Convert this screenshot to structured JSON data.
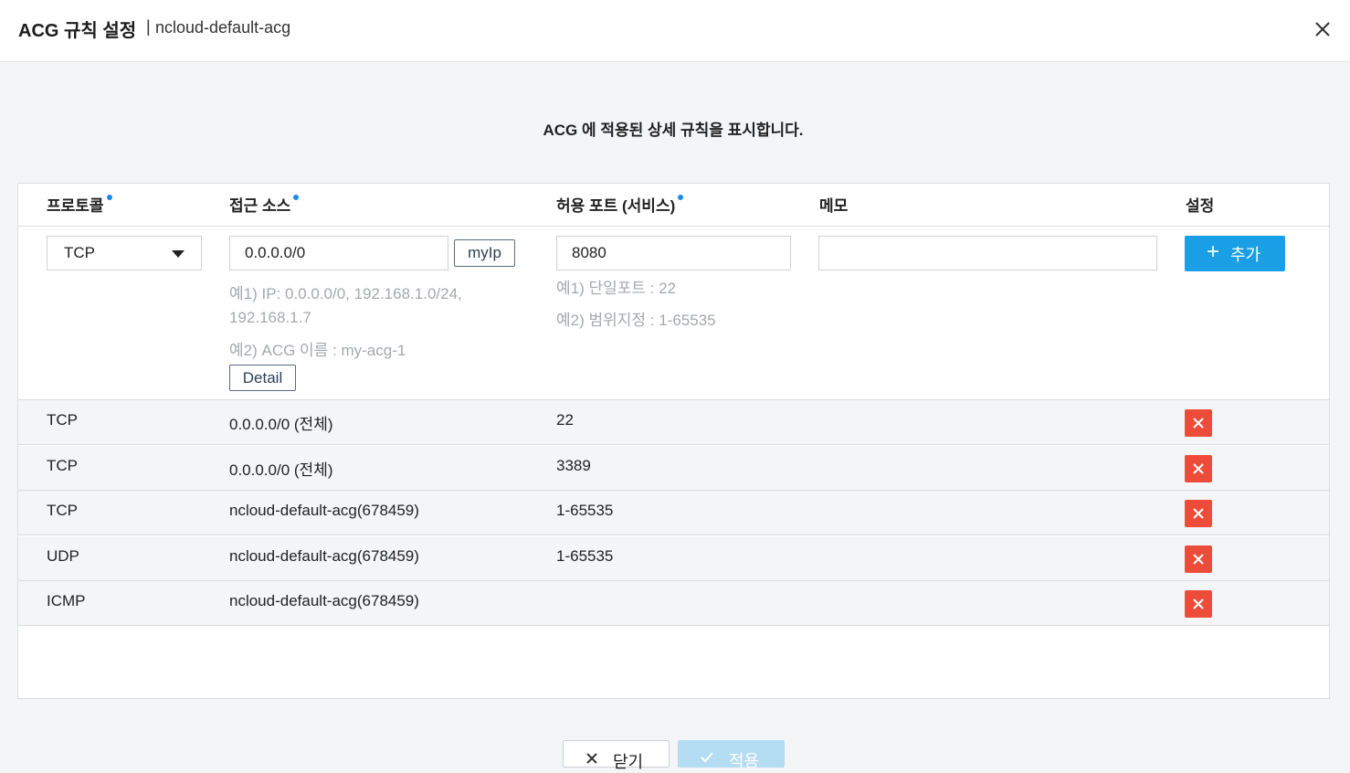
{
  "header": {
    "title": "ACG 규칙 설정",
    "separator": "|",
    "subtitle": "ncloud-default-acg"
  },
  "description": "ACG 에 적용된 상세 규칙을 표시합니다.",
  "table": {
    "columns": {
      "protocol": "프로토콜",
      "source": "접근 소스",
      "port": "허용 포트 (서비스)",
      "memo": "메모",
      "settings": "설정"
    },
    "form": {
      "protocol_value": "TCP",
      "source_value": "0.0.0.0/0",
      "myip_label": "myIp",
      "source_hint1a": "예1) IP: 0.0.0.0/0, 192.168.1.0/24,",
      "source_hint1b": "192.168.1.7",
      "source_hint2": "예2) ACG 이름 : my-acg-1",
      "detail_label": "Detail",
      "port_value": "8080",
      "port_hint1": "예1) 단일포트 : 22",
      "port_hint2": "예2) 범위지정 : 1-65535",
      "memo_value": "",
      "add_label": "추가",
      "add_icon": "+"
    },
    "rows": [
      {
        "protocol": "TCP",
        "source": "0.0.0.0/0 (전체)",
        "port": "22"
      },
      {
        "protocol": "TCP",
        "source": "0.0.0.0/0 (전체)",
        "port": "3389"
      },
      {
        "protocol": "TCP",
        "source": "ncloud-default-acg(678459)",
        "port": "1-65535"
      },
      {
        "protocol": "UDP",
        "source": "ncloud-default-acg(678459)",
        "port": "1-65535"
      },
      {
        "protocol": "ICMP",
        "source": "ncloud-default-acg(678459)",
        "port": ""
      }
    ]
  },
  "footer": {
    "close_label": "닫기",
    "apply_label": "적용"
  },
  "colors": {
    "accent": "#1a9ee6",
    "required_dot": "#1a8ce8",
    "delete": "#ee4c3a"
  }
}
